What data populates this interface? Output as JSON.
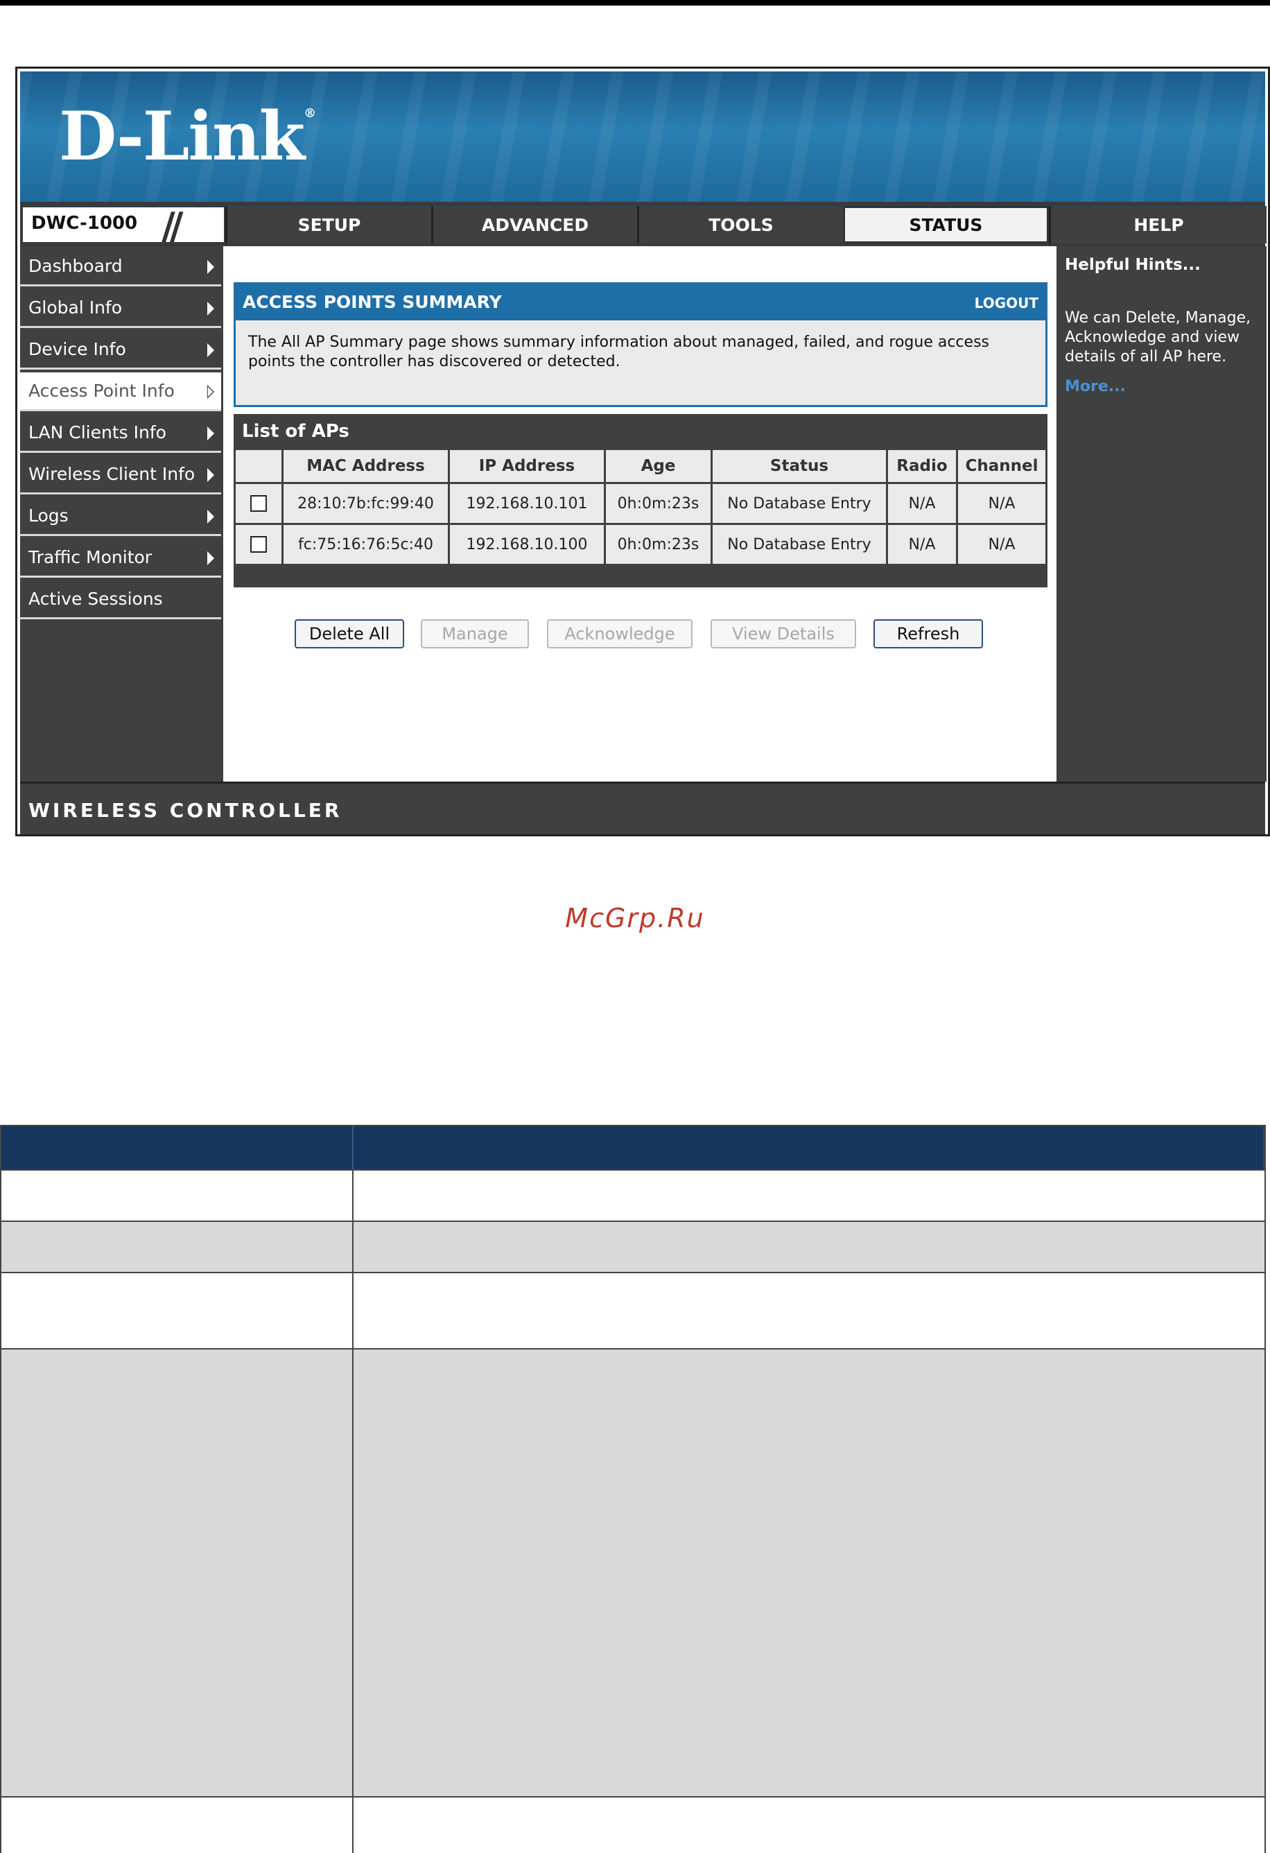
{
  "banner": {
    "logo": "D-Link",
    "registered": "®"
  },
  "model": "DWC-1000",
  "tabs": [
    {
      "label": "SETUP"
    },
    {
      "label": "ADVANCED"
    },
    {
      "label": "TOOLS"
    },
    {
      "label": "STATUS",
      "active": true
    },
    {
      "label": "HELP"
    }
  ],
  "sidebar": {
    "items": [
      {
        "label": "Dashboard"
      },
      {
        "label": "Global Info"
      },
      {
        "label": "Device Info"
      },
      {
        "label": "Access Point Info",
        "active": true
      },
      {
        "label": "LAN Clients Info"
      },
      {
        "label": "Wireless Client Info"
      },
      {
        "label": "Logs"
      },
      {
        "label": "Traffic Monitor"
      },
      {
        "label": "Active Sessions"
      }
    ]
  },
  "summary": {
    "title": "ACCESS POINTS SUMMARY",
    "logout": "LOGOUT",
    "description": "The All AP Summary page shows summary information about managed, failed, and rogue access points the controller has discovered or detected."
  },
  "ap_list": {
    "title": "List of APs",
    "columns": [
      "",
      "MAC Address",
      "IP Address",
      "Age",
      "Status",
      "Radio",
      "Channel"
    ],
    "rows": [
      {
        "mac": "28:10:7b:fc:99:40",
        "ip": "192.168.10.101",
        "age": "0h:0m:23s",
        "status": "No Database Entry",
        "radio": "N/A",
        "channel": "N/A"
      },
      {
        "mac": "fc:75:16:76:5c:40",
        "ip": "192.168.10.100",
        "age": "0h:0m:23s",
        "status": "No Database Entry",
        "radio": "N/A",
        "channel": "N/A"
      }
    ]
  },
  "buttons": {
    "delete_all": "Delete All",
    "manage": "Manage",
    "acknowledge": "Acknowledge",
    "view_details": "View Details",
    "refresh": "Refresh"
  },
  "help": {
    "title": "Helpful Hints...",
    "text": "We can Delete, Manage, Acknowledge and view details of all AP here.",
    "more": "More..."
  },
  "footer": "WIRELESS CONTROLLER",
  "watermark": "McGrp.Ru",
  "colors": {
    "banner": "#1e6fa8",
    "nav_dark": "#404040",
    "table_header": "#17365d",
    "row_gray": "#d9d9d9",
    "watermark": "#c0392b"
  }
}
